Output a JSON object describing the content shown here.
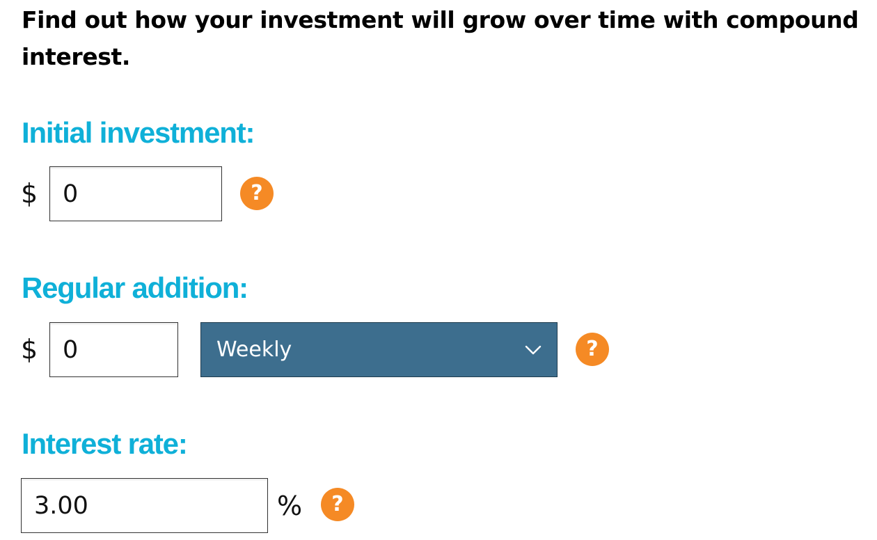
{
  "intro": {
    "text": "Find out how your investment will grow over time with compound interest."
  },
  "initial_investment": {
    "label": "Initial investment:",
    "currency_symbol": "$",
    "value": "0",
    "help_icon": "question-icon",
    "help_glyph": "?"
  },
  "regular_addition": {
    "label": "Regular addition:",
    "currency_symbol": "$",
    "value": "0",
    "frequency": {
      "selected": "Weekly",
      "icon": "chevron-down-icon"
    },
    "help_icon": "question-icon",
    "help_glyph": "?"
  },
  "interest_rate": {
    "label": "Interest rate:",
    "value": "3.00",
    "unit": "%",
    "help_icon": "question-icon",
    "help_glyph": "?"
  },
  "colors": {
    "label_accent": "#0fb0d8",
    "help_badge": "#f58a25",
    "select_background": "#3d6e8e"
  }
}
